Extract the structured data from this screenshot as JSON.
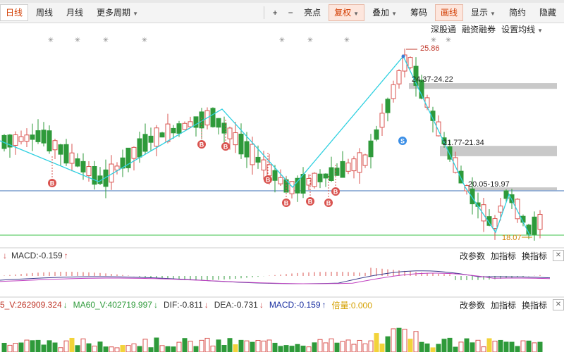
{
  "toolbar": {
    "items": [
      {
        "label": "日线",
        "active": true
      },
      {
        "label": "周线"
      },
      {
        "label": "月线"
      },
      {
        "label": "更多周期",
        "caret": true
      }
    ],
    "plus": "+",
    "minus": "−",
    "highlight": "亮点",
    "adjust": "复权",
    "overlay": "叠加",
    "chips": "筹码",
    "draw": "画线",
    "display": "显示",
    "simple": "简约",
    "hide": "隐藏"
  },
  "subbar": {
    "a": "深股通",
    "b": "融资融券",
    "c": "设置均线"
  },
  "price_labels": {
    "high": "25.86",
    "zone1": "24.37-24.22",
    "zone2": "21.77-21.34",
    "zone3": "20.05-19.97",
    "low": "18.07"
  },
  "markers": {
    "buy": "B",
    "sell": "S",
    "star": "✳"
  },
  "macd_header": {
    "text": "MACD:-0.159",
    "arrow": "↑",
    "btn1": "改参数",
    "btn2": "加指标",
    "btn3": "换指标",
    "close": "✕"
  },
  "vol_header": {
    "v": "5_V:262909.324",
    "v_arrow": "↓",
    "ma60": "MA60_V:402719.997",
    "ma60_arrow": "↓",
    "dif": "DIF:-0.811",
    "dif_arrow": "↓",
    "dea": "DEA:-0.731",
    "dea_arrow": "↓",
    "macd": "MACD:-0.159",
    "macd_arrow": "↑",
    "bei": "倍量:0.000",
    "btn1": "改参数",
    "btn2": "加指标",
    "btn3": "换指标",
    "close": "✕"
  },
  "colors": {
    "up": "#d9534f",
    "down": "#2e9a3a",
    "zigzag": "#2fd0e0",
    "hline_blue": "#3a6cb5",
    "hline_green": "#3cc24a",
    "zone": "#c9c9c9"
  }
}
